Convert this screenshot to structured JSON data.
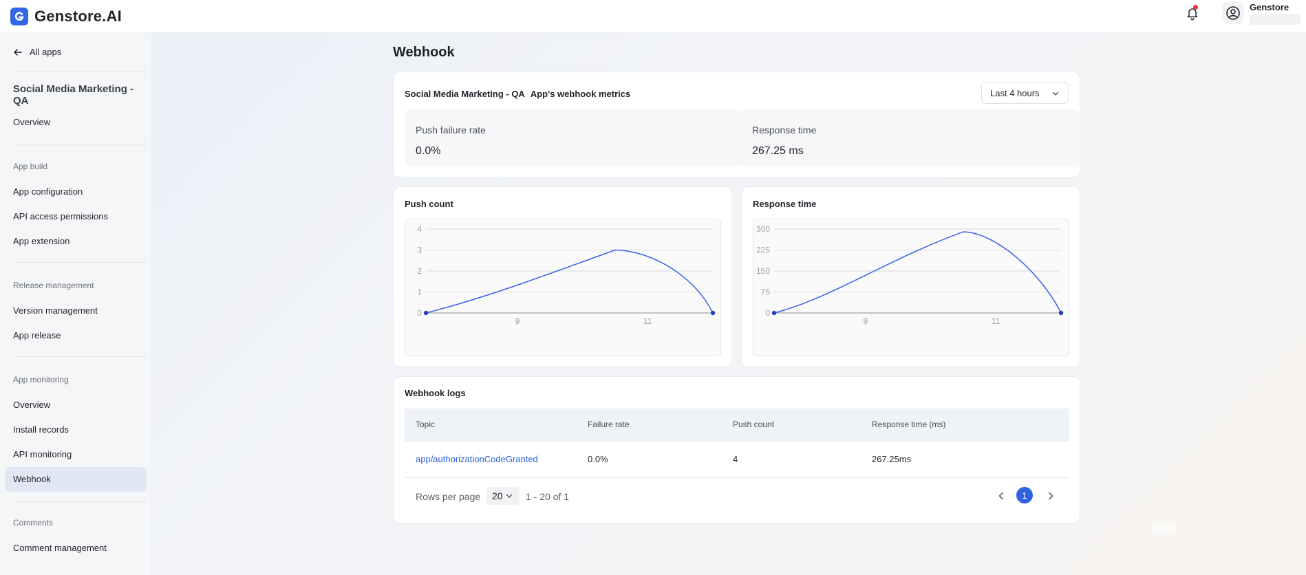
{
  "brand": {
    "name": "Genstore.AI"
  },
  "user": {
    "name": "Genstore"
  },
  "sidebar": {
    "back_label": "All apps",
    "app_title": "Social Media Marketing - QA",
    "overview": "Overview",
    "sections": [
      {
        "title": "App build",
        "items": [
          "App configuration",
          "API access permissions",
          "App extension"
        ]
      },
      {
        "title": "Release management",
        "items": [
          "Version management",
          "App release"
        ]
      },
      {
        "title": "App monitoring",
        "items": [
          "Overview",
          "Install records",
          "API monitoring",
          "Webhook"
        ]
      },
      {
        "title": "Comments",
        "items": [
          "Comment management"
        ]
      }
    ],
    "active_item": "Webhook"
  },
  "page": {
    "title": "Webhook"
  },
  "metrics": {
    "app_name": "Social Media Marketing - QA",
    "subtitle": "App's webhook metrics",
    "time_range": "Last 4 hours",
    "push_failure_rate": {
      "label": "Push failure rate",
      "value": "0.0%"
    },
    "response_time": {
      "label": "Response time",
      "value": "267.25 ms"
    }
  },
  "chart_data": [
    {
      "type": "line",
      "title": "Push count",
      "x": [
        7.6,
        10.5,
        12.0
      ],
      "x_ticks": [
        "9",
        "11"
      ],
      "y_ticks": [
        "0",
        "1",
        "2",
        "3",
        "4"
      ],
      "ylim": [
        0,
        4
      ],
      "series": [
        {
          "values": [
            0,
            3,
            0
          ],
          "color": "#3a5fe5"
        }
      ]
    },
    {
      "type": "line",
      "title": "Response time",
      "x": [
        7.6,
        10.5,
        12.0
      ],
      "x_ticks": [
        "9",
        "11"
      ],
      "y_ticks": [
        "0",
        "75",
        "150",
        "225",
        "300"
      ],
      "ylim": [
        0,
        300
      ],
      "series": [
        {
          "values": [
            0,
            290,
            0
          ],
          "color": "#3a5fe5"
        }
      ]
    }
  ],
  "logs": {
    "title": "Webhook logs",
    "columns": [
      "Topic",
      "Failure rate",
      "Push count",
      "Response time (ms)"
    ],
    "rows": [
      [
        "app/authorizationCodeGranted",
        "0.0%",
        "4",
        "267.25ms"
      ]
    ],
    "rows_per_page_label": "Rows per page",
    "rows_per_page": "20",
    "range_text": "1 - 20 of 1",
    "current_page": "1"
  },
  "colors": {
    "accent": "#2f63e0",
    "line": "#3a5fe5"
  }
}
